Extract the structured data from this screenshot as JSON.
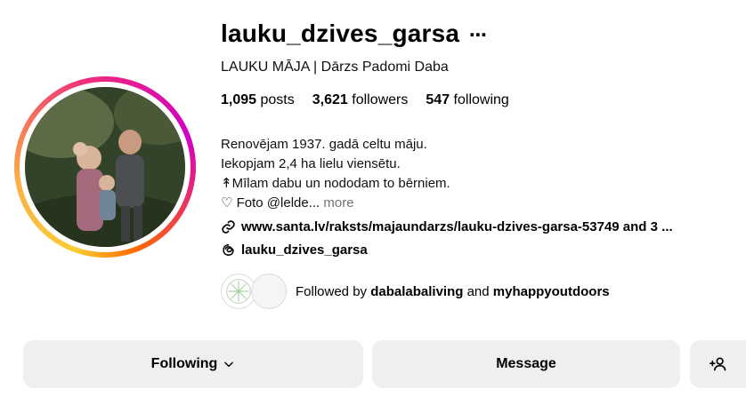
{
  "profile": {
    "username": "lauku_dzives_garsa",
    "more_icon": "⋯",
    "fullname": "LAUKU MĀJA | Dārzs Padomi Daba",
    "stats": {
      "posts_count": "1,095",
      "posts_label": "posts",
      "followers_count": "3,621",
      "followers_label": "followers",
      "following_count": "547",
      "following_label": "following"
    },
    "bio": [
      "Renovējam 1937. gadā celtu māju.",
      "Iekopjam 2,4 ha lielu viensētu.",
      "↟Mīlam dabu un nododam to bērniem.",
      "♡ Foto @lelde..."
    ],
    "bio_more": "more",
    "link": "www.santa.lv/raksts/majaundarzs/lauku-dzives-garsa-53749 and 3 ...",
    "threads": "lauku_dzives_garsa",
    "followed_by": {
      "prefix": "Followed by",
      "user1": "dabalabaliving",
      "and": "and",
      "user2": "myhappyoutdoors"
    }
  },
  "buttons": {
    "following": "Following",
    "message": "Message"
  }
}
